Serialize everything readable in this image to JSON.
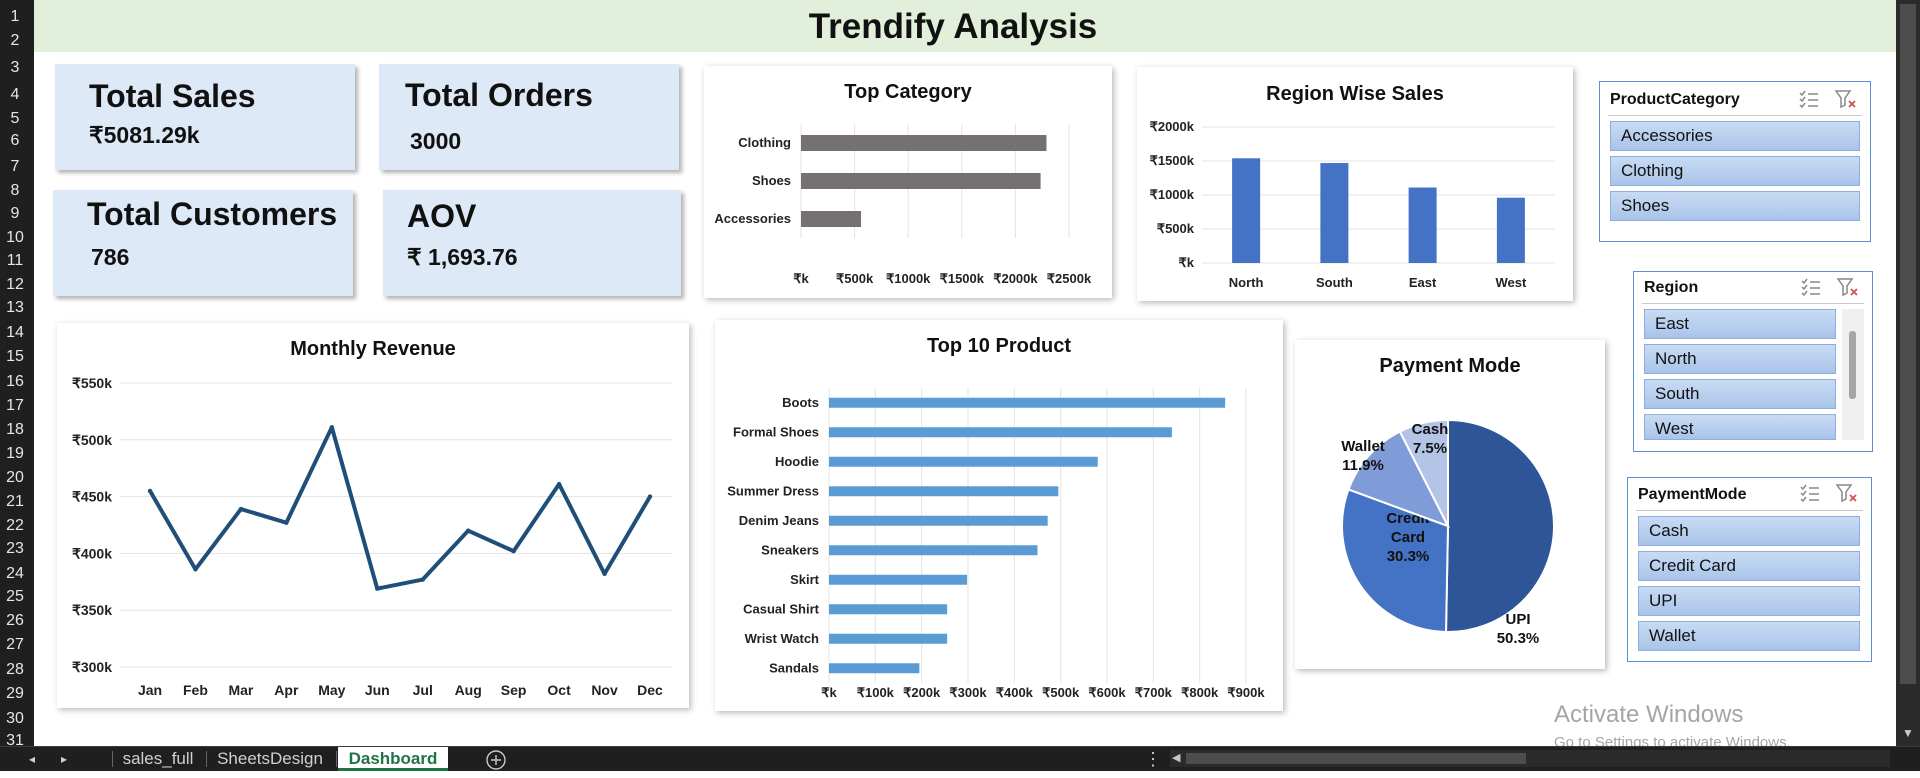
{
  "title": "Trendify Analysis",
  "row_numbers": [
    "1",
    "2",
    "3",
    "4",
    "5",
    "6",
    "7",
    "8",
    "9",
    "10",
    "11",
    "12",
    "13",
    "14",
    "15",
    "16",
    "17",
    "18",
    "19",
    "20",
    "21",
    "22",
    "23",
    "24",
    "25",
    "26",
    "27",
    "28",
    "29",
    "30",
    "31"
  ],
  "kpis": {
    "total_sales": {
      "label": "Total Sales",
      "value": "₹5081.29k"
    },
    "total_orders": {
      "label": "Total Orders",
      "value": "3000"
    },
    "total_customers": {
      "label": "Total Customers",
      "value": "786"
    },
    "aov": {
      "label": "AOV",
      "value": "₹ 1,693.76"
    }
  },
  "colors": {
    "bar_gray": "#767171",
    "bar_blue": "#4472c4",
    "bar_lightblue": "#5b9bd5",
    "line": "#1f4e79",
    "header_green": "#e2efda",
    "kpi_bg": "#dde9f6"
  },
  "chart_data": [
    {
      "type": "bar",
      "orientation": "horizontal",
      "title": "Top Category",
      "categories": [
        "Clothing",
        "Shoes",
        "Accessories"
      ],
      "values": [
        2290,
        2235,
        560
      ],
      "xlim": [
        0,
        2500
      ],
      "x_ticks": [
        "₹k",
        "₹500k",
        "₹1000k",
        "₹1500k",
        "₹2000k",
        "₹2500k"
      ],
      "grid": true
    },
    {
      "type": "bar",
      "title": "Region Wise Sales",
      "categories": [
        "North",
        "South",
        "East",
        "West"
      ],
      "values": [
        1540,
        1470,
        1110,
        960
      ],
      "ylim": [
        0,
        2000
      ],
      "y_ticks": [
        "₹k",
        "₹500k",
        "₹1000k",
        "₹1500k",
        "₹2000k"
      ],
      "grid": true
    },
    {
      "type": "line",
      "title": "Monthly Revenue",
      "categories": [
        "Jan",
        "Feb",
        "Mar",
        "Apr",
        "May",
        "Jun",
        "Jul",
        "Aug",
        "Sep",
        "Oct",
        "Nov",
        "Dec"
      ],
      "values": [
        455,
        386,
        439,
        427,
        511,
        369,
        377,
        420,
        402,
        461,
        382,
        450
      ],
      "ylim": [
        300,
        550
      ],
      "y_ticks": [
        "₹300k",
        "₹350k",
        "₹400k",
        "₹450k",
        "₹500k",
        "₹550k"
      ],
      "grid": true
    },
    {
      "type": "bar",
      "orientation": "horizontal",
      "title": "Top 10 Product",
      "categories": [
        "Boots",
        "Formal Shoes",
        "Hoodie",
        "Summer Dress",
        "Denim Jeans",
        "Sneakers",
        "Skirt",
        "Casual Shirt",
        "Wrist Watch",
        "Sandals"
      ],
      "values": [
        855,
        740,
        580,
        495,
        472,
        450,
        298,
        255,
        255,
        195
      ],
      "xlim": [
        0,
        900
      ],
      "x_ticks": [
        "₹k",
        "₹100k",
        "₹200k",
        "₹300k",
        "₹400k",
        "₹500k",
        "₹600k",
        "₹700k",
        "₹800k",
        "₹900k"
      ],
      "grid": true
    },
    {
      "type": "pie",
      "title": "Payment Mode",
      "slices": [
        {
          "label": "UPI",
          "pct_label": "50.3%",
          "value": 50.3,
          "color": "#2e5597"
        },
        {
          "label": "Credit Card",
          "pct_label": "30.3%",
          "value": 30.3,
          "color": "#4472c4"
        },
        {
          "label": "Wallet",
          "pct_label": "11.9%",
          "value": 11.9,
          "color": "#7f9bd8"
        },
        {
          "label": "Cash",
          "pct_label": "7.5%",
          "value": 7.5,
          "color": "#b4c4e7"
        }
      ]
    }
  ],
  "slicers": {
    "product_category": {
      "title": "ProductCategory",
      "items": [
        "Accessories",
        "Clothing",
        "Shoes"
      ]
    },
    "region": {
      "title": "Region",
      "items": [
        "East",
        "North",
        "South",
        "West"
      ]
    },
    "payment_mode": {
      "title": "PaymentMode",
      "items": [
        "Cash",
        "Credit Card",
        "UPI",
        "Wallet"
      ]
    }
  },
  "tabs": [
    "sales_full",
    "SheetsDesign",
    "Dashboard"
  ],
  "active_tab": "Dashboard",
  "watermark": {
    "line1": "Activate Windows",
    "line2": "Go to Settings to activate Windows."
  }
}
